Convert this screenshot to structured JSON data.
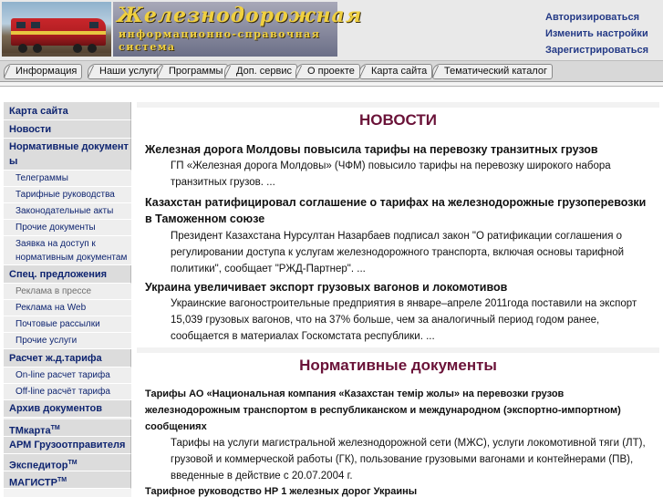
{
  "header": {
    "logo_title": "Железнодорожная",
    "logo_line2": "информационно-справочная",
    "logo_line3": "система",
    "user_links": [
      "Авторизироваться",
      "Изменить настройки",
      "Зарегистрироваться"
    ]
  },
  "topnav": {
    "items": [
      "Информация",
      "Наши услуги",
      "Программы",
      "Доп. сервис",
      "О проекте",
      "Карта сайта",
      "Тематический каталог"
    ]
  },
  "sidebar": {
    "site_map": "Карта сайта",
    "news": "Новости",
    "norm_docs_1": "Нормативные документ",
    "norm_docs_2": "ы",
    "norm_subs": [
      "Телеграммы",
      "Тарифные руководства",
      "Законодательные акты",
      "Прочие документы"
    ],
    "access_request_1": "Заявка на доступ к",
    "access_request_2": "нормативным документам",
    "special_offers": "Спец. предложения",
    "offer_subs": [
      "Реклама в прессе",
      "Реклама на Web",
      "Почтовые рассылки",
      "Прочие услуги"
    ],
    "tariff_calc": "Расчет ж.д.тарифа",
    "tariff_subs": [
      "On-line расчет тарифа",
      "Off-line расчёт тарифа"
    ],
    "docs_archive": "Архив документов",
    "tm_map": "ТМкарта",
    "arm": "АРМ Грузоотправителя",
    "forwarder": "Экспедитор",
    "magistr": "МАГИСТР",
    "tm": "TM"
  },
  "news": {
    "title": "НОВОСТИ",
    "items": [
      {
        "headline": "Железная дорога Молдовы повысила тарифы на перевозку транзитных грузов",
        "text": "ГП «Железная дорога Молдовы» (ЧФМ) повысило тарифы на перевозку широкого набора транзитных грузов. ..."
      },
      {
        "headline": "Казахстан ратифицировал соглашение о тарифах на железнодорожные грузоперевозки в Таможенном союзе",
        "text": "Президент Казахстана Нурсултан Назарбаев подписал закон \"О ратификации соглашения о регулировании доступа к услугам железнодорожного транспорта, включая основы тарифной политики\", сообщает \"РЖД-Партнер\". ..."
      },
      {
        "headline": "Украина увеличивает экспорт грузовых вагонов и локомотивов",
        "text": "Украинские вагоностроительные предприятия в январе–апреле 2011года поставили на экспорт 15,039 грузовых вагонов, что на 37% больше, чем за аналогичный период годом ранее, сообщается в материалах Госкомстата республики. ..."
      }
    ]
  },
  "docs": {
    "title": "Нормативные документы",
    "items": [
      {
        "headline": "Тарифы АО «Национальная компания «Казахстан темір жолы» на перевозки грузов железнодорожным транспортом в республиканском и международном (экспортно-импортном) сообщениях",
        "text": "Тарифы на услуги магистральной железнодорожной сети (МЖС), услуги локомотивной тяги (ЛТ), грузовой и коммерческой работы (ГК), пользование грузовыми вагонами и контейнерами (ПВ), введенные в действие с 20.07.2004 г."
      },
      {
        "headline": "Тарифное руководство НР 1 железных дорог Украины"
      }
    ]
  },
  "colors": {
    "accent_link": "#243a86",
    "sidebar_link": "#0e2470",
    "section_title": "#6a1238"
  }
}
